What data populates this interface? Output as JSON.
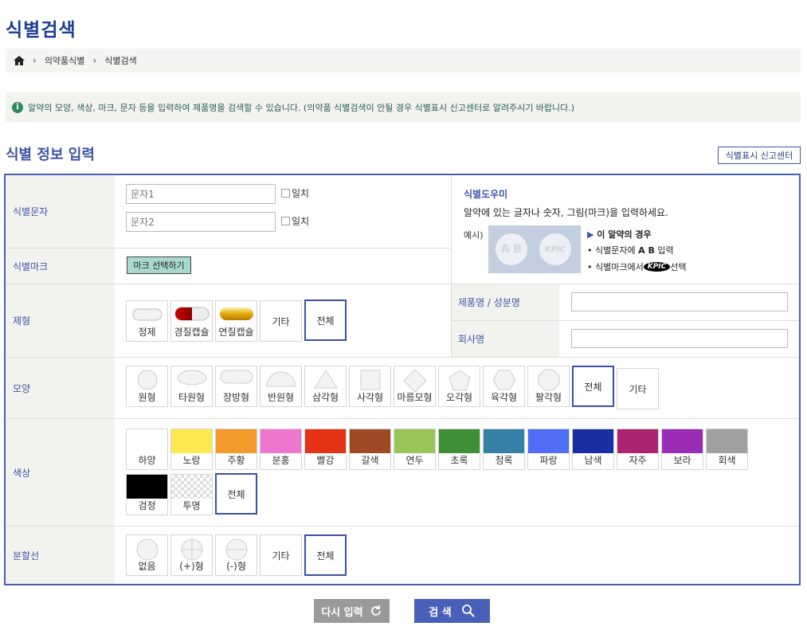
{
  "page": {
    "title": "식별검색"
  },
  "breadcrumb": {
    "level1": "의약품식별",
    "level2": "식별검색"
  },
  "notice": "알약의 모양, 색상, 마크, 문자 등을 입력하여 제품명을 검색할 수 있습니다. (의약품 식별검색이 안될 경우 식별표시 신고센터로 알려주시기 바랍니다.)",
  "section": {
    "title": "식별 정보 입력",
    "report_button": "식별표시 신고센터"
  },
  "labels": {
    "char": "식별문자",
    "mark": "식별마크",
    "form": "제형",
    "shape": "모양",
    "color": "색상",
    "line": "분할선",
    "product": "제품명 / 성분명",
    "company": "회사명"
  },
  "inputs": {
    "char1_placeholder": "문자1",
    "char2_placeholder": "문자2",
    "exact": "일치",
    "product_value": "",
    "company_value": ""
  },
  "mark_button": "마크 선택하기",
  "help": {
    "title": "식별도우미",
    "desc": "알약에 있는 글자나 숫자, 그림(마크)을 입력하세요.",
    "example": "예시)",
    "pill1": "A B",
    "pill2": "KPIC",
    "case": "이 알약의 경우",
    "tip1a": "식별문자에 ",
    "tip1b": "A B",
    "tip1c": " 입력",
    "tip2a": "식별마크에서 ",
    "tip2b": "KPIC",
    "tip2c": " 선택"
  },
  "forms": [
    "정제",
    "경질캡슐",
    "연질캡슐",
    "기타",
    "전체"
  ],
  "shapes": [
    "원형",
    "타원형",
    "장방형",
    "반원형",
    "삼각형",
    "사각형",
    "마름모형",
    "오각형",
    "육각형",
    "팔각형",
    "전체",
    "기타"
  ],
  "colors": [
    {
      "name": "하양",
      "hex": "#ffffff"
    },
    {
      "name": "노랑",
      "hex": "#fde84f"
    },
    {
      "name": "주황",
      "hex": "#f39a2a"
    },
    {
      "name": "분홍",
      "hex": "#ef76cf"
    },
    {
      "name": "빨강",
      "hex": "#e53216"
    },
    {
      "name": "갈색",
      "hex": "#9e4b25"
    },
    {
      "name": "연두",
      "hex": "#98c45a"
    },
    {
      "name": "초록",
      "hex": "#3e8f38"
    },
    {
      "name": "청록",
      "hex": "#3680a5"
    },
    {
      "name": "파랑",
      "hex": "#4f6ef5"
    },
    {
      "name": "남색",
      "hex": "#1a2ea3"
    },
    {
      "name": "자주",
      "hex": "#aa2470"
    },
    {
      "name": "보라",
      "hex": "#9a2cb5"
    },
    {
      "name": "회색",
      "hex": "#a0a0a0"
    },
    {
      "name": "검정",
      "hex": "#000000"
    },
    {
      "name": "투명",
      "hex": "transparent"
    }
  ],
  "color_all": "전체",
  "lines": [
    "없음",
    "(+)형",
    "(-)형",
    "기타",
    "전체"
  ],
  "buttons": {
    "reset": "다시 입력",
    "search": "검 색"
  }
}
